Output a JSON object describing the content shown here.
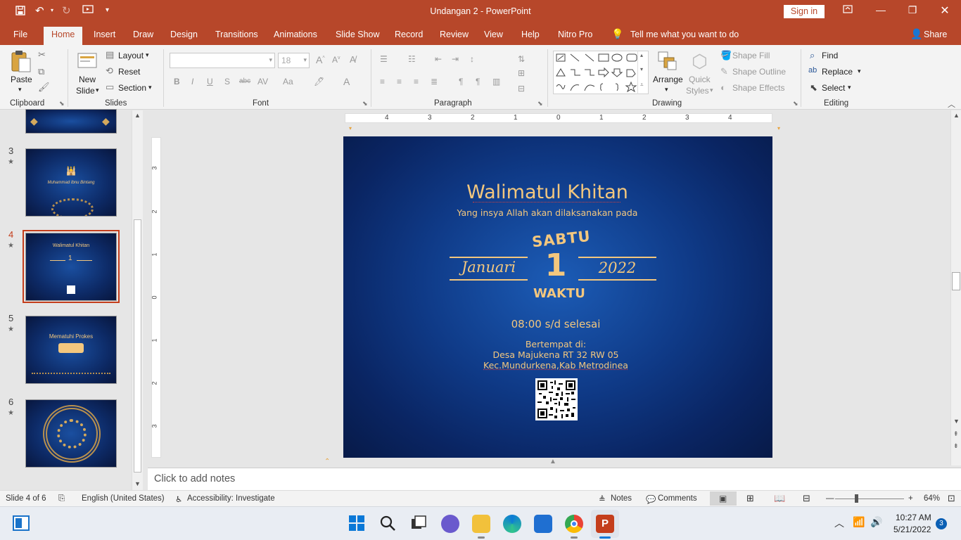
{
  "app": {
    "doc_title": "Undangan 2  -  PowerPoint",
    "sign_in": "Sign in",
    "tabs": [
      "File",
      "Home",
      "Insert",
      "Draw",
      "Design",
      "Transitions",
      "Animations",
      "Slide Show",
      "Record",
      "Review",
      "View",
      "Help",
      "Nitro Pro"
    ],
    "tell_me": "Tell me what you want to do",
    "share": "Share"
  },
  "ribbon": {
    "clipboard": {
      "paste": "Paste",
      "label": "Clipboard"
    },
    "slides": {
      "new_slide_1": "New",
      "new_slide_2": "Slide",
      "layout": "Layout",
      "reset": "Reset",
      "section": "Section",
      "label": "Slides"
    },
    "font": {
      "size": "18",
      "label": "Font"
    },
    "paragraph": {
      "label": "Paragraph"
    },
    "drawing": {
      "arrange": "Arrange",
      "quick_styles_1": "Quick",
      "quick_styles_2": "Styles",
      "shape_fill": "Shape Fill",
      "shape_outline": "Shape Outline",
      "shape_effects": "Shape Effects",
      "label": "Drawing"
    },
    "editing": {
      "find": "Find",
      "replace": "Replace",
      "select": "Select",
      "label": "Editing"
    }
  },
  "thumbnails": [
    {
      "num": "3",
      "star": "★",
      "title": "Muhammad Ibnu Bintang"
    },
    {
      "num": "4",
      "star": "★",
      "title": "Walimatul Khitan",
      "selected": true
    },
    {
      "num": "5",
      "star": "★",
      "title": "Mematuhi Prokes"
    },
    {
      "num": "6",
      "star": "★",
      "title": ""
    }
  ],
  "ruler": {
    "h_ticks": [
      "4",
      "3",
      "2",
      "1",
      "0",
      "1",
      "2",
      "3",
      "4"
    ],
    "v_ticks": [
      "3",
      "2",
      "1",
      "0",
      "1",
      "2",
      "3"
    ]
  },
  "slide": {
    "title": "Walimatul Khitan",
    "subtitle": "Yang insya Allah akan dilaksanakan pada",
    "day": "SABTU",
    "date": "1",
    "month": "Januari",
    "year": "2022",
    "waktu": "WAKTU",
    "time": "08:00 s/d selesai",
    "place_label": "Bertempat di:",
    "place_1": "Desa Majukena RT 32 RW 05",
    "place_2": "Kec.Mundurkena,Kab Metrodinea"
  },
  "notes": {
    "placeholder": "Click to add notes"
  },
  "status": {
    "slide_count": "Slide 4 of 6",
    "language": "English (United States)",
    "accessibility": "Accessibility: Investigate",
    "notes": "Notes",
    "comments": "Comments",
    "zoom": "64%"
  },
  "taskbar": {
    "time": "10:27 AM",
    "date": "5/21/2022",
    "badge": "3"
  },
  "colors": {
    "accent": "#b7472a",
    "slide_gold": "#f3c77e",
    "slide_blue": "#0f3a87"
  }
}
